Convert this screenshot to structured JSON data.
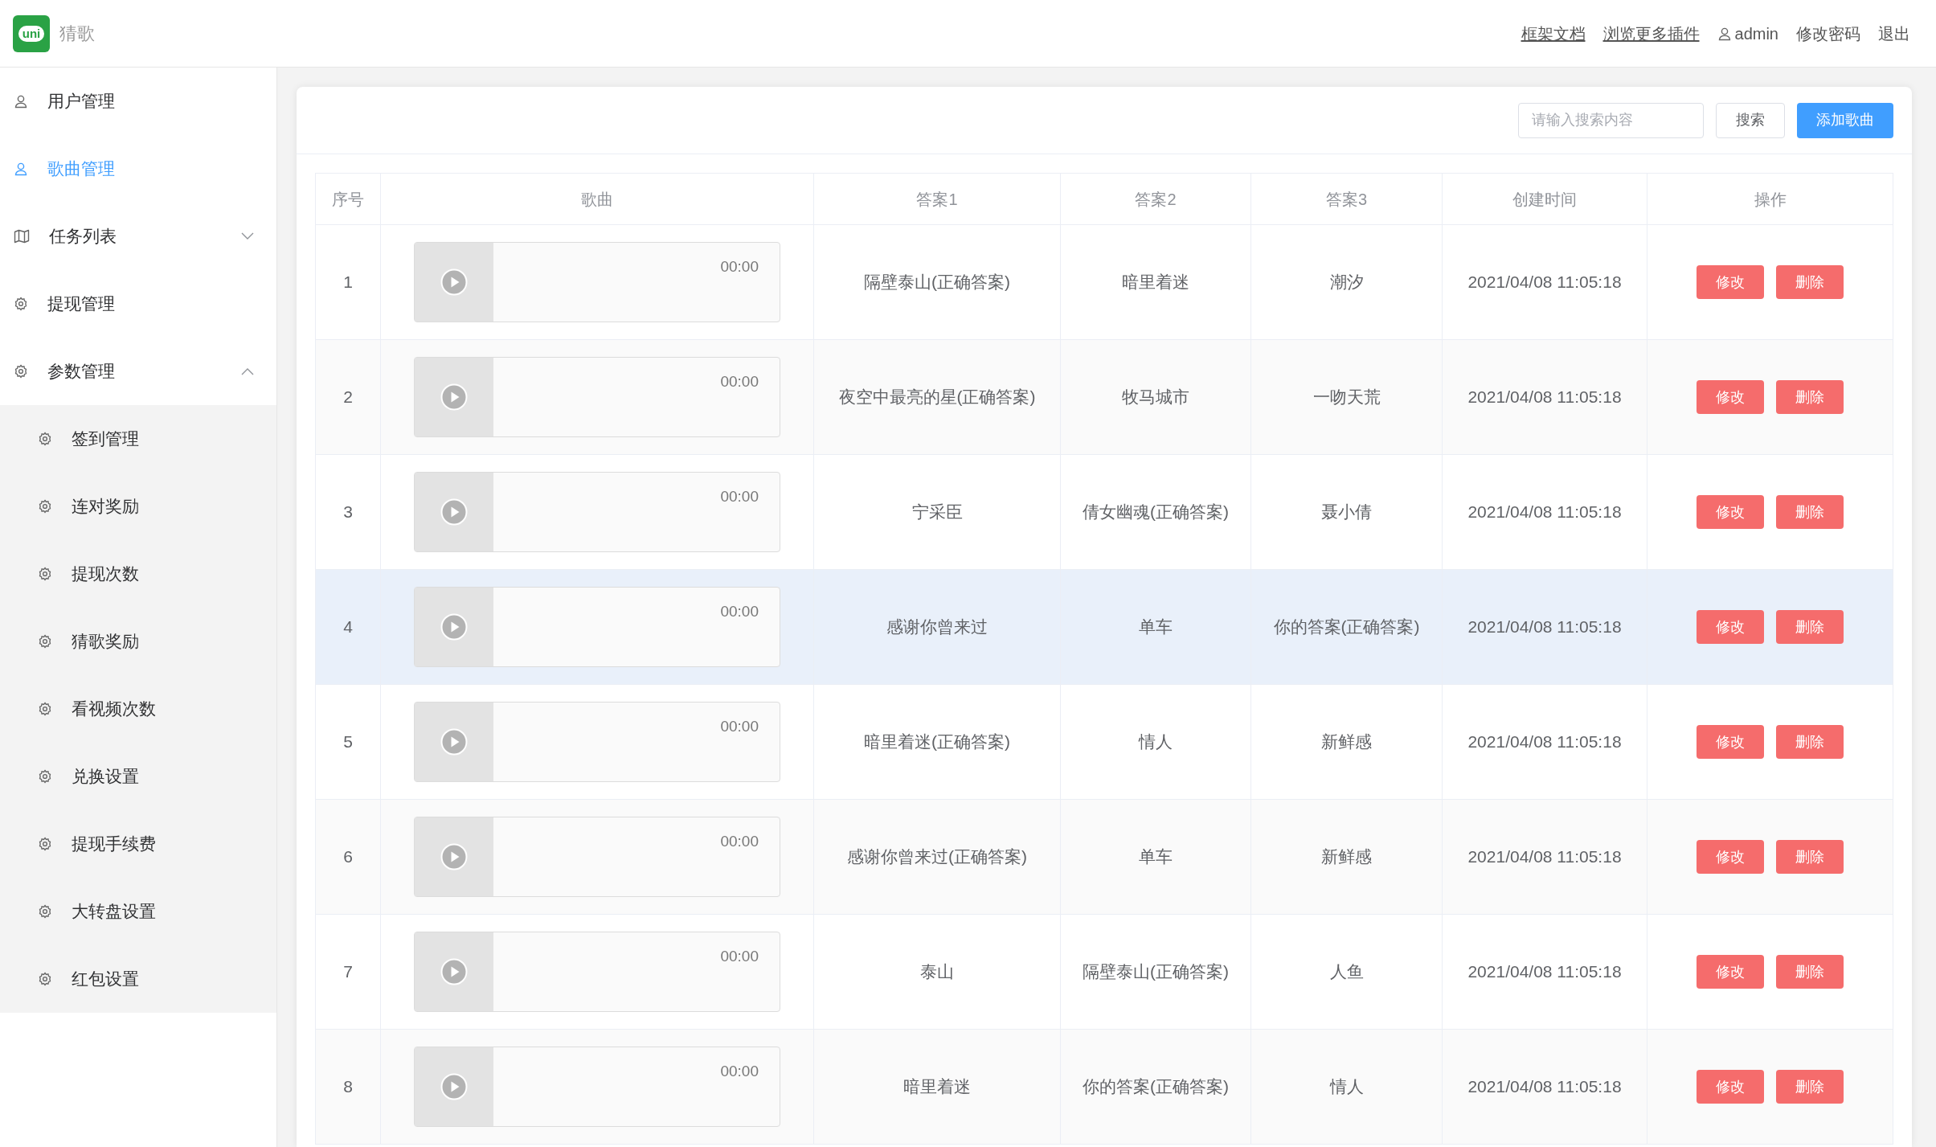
{
  "header": {
    "logo_text": "uni",
    "app_name": "猜歌",
    "links": [
      {
        "label": "框架文档",
        "kind": "link"
      },
      {
        "label": "浏览更多插件",
        "kind": "link"
      },
      {
        "label": "admin",
        "kind": "user"
      },
      {
        "label": "修改密码",
        "kind": "plain"
      },
      {
        "label": "退出",
        "kind": "plain"
      }
    ]
  },
  "sidebar": {
    "items": [
      {
        "label": "用户管理",
        "kind": "user",
        "selected": false
      },
      {
        "label": "歌曲管理",
        "kind": "user",
        "selected": true
      },
      {
        "label": "任务列表",
        "kind": "map",
        "selected": false,
        "expanded": false
      },
      {
        "label": "提现管理",
        "kind": "gear",
        "selected": false
      },
      {
        "label": "参数管理",
        "kind": "gear",
        "selected": false,
        "expanded": true,
        "children": [
          {
            "label": "签到管理",
            "selected": false
          },
          {
            "label": "连对奖励",
            "selected": false
          },
          {
            "label": "提现次数",
            "selected": false
          },
          {
            "label": "猜歌奖励",
            "selected": false
          },
          {
            "label": "看视频次数",
            "selected": false
          },
          {
            "label": "兑换设置",
            "selected": false
          },
          {
            "label": "提现手续费",
            "selected": false
          },
          {
            "label": "大转盘设置",
            "selected": false
          },
          {
            "label": "红包设置",
            "selected": false
          }
        ]
      }
    ]
  },
  "toolbar": {
    "search": {
      "placeholder": "请输入搜索内容"
    },
    "search_button": "搜索",
    "add_button": "添加歌曲"
  },
  "table": {
    "columns": [
      "序号",
      "歌曲",
      "答案1",
      "答案2",
      "答案3",
      "创建时间",
      "操作"
    ],
    "rows": [
      {
        "index": "1",
        "time_display": "00:00",
        "answer1": "隔壁泰山(正确答案)",
        "answer2": "暗里着迷",
        "answer3": "潮汐",
        "created": "2021/04/08 11:05:18",
        "actions": [
          "修改",
          "删除"
        ],
        "highlighted": false
      },
      {
        "index": "2",
        "time_display": "00:00",
        "answer1": "夜空中最亮的星(正确答案)",
        "answer2": "牧马城市",
        "answer3": "一吻天荒",
        "created": "2021/04/08 11:05:18",
        "actions": [
          "修改",
          "删除"
        ],
        "highlighted": false
      },
      {
        "index": "3",
        "time_display": "00:00",
        "answer1": "宁采臣",
        "answer2": "倩女幽魂(正确答案)",
        "answer3": "聂小倩",
        "created": "2021/04/08 11:05:18",
        "actions": [
          "修改",
          "删除"
        ],
        "highlighted": false
      },
      {
        "index": "4",
        "time_display": "00:00",
        "answer1": "感谢你曾来过",
        "answer2": "单车",
        "answer3": "你的答案(正确答案)",
        "created": "2021/04/08 11:05:18",
        "actions": [
          "修改",
          "删除"
        ],
        "highlighted": true
      },
      {
        "index": "5",
        "time_display": "00:00",
        "answer1": "暗里着迷(正确答案)",
        "answer2": "情人",
        "answer3": "新鲜感",
        "created": "2021/04/08 11:05:18",
        "actions": [
          "修改",
          "删除"
        ],
        "highlighted": false
      },
      {
        "index": "6",
        "time_display": "00:00",
        "answer1": "感谢你曾来过(正确答案)",
        "answer2": "单车",
        "answer3": "新鲜感",
        "created": "2021/04/08 11:05:18",
        "actions": [
          "修改",
          "删除"
        ],
        "highlighted": false
      },
      {
        "index": "7",
        "time_display": "00:00",
        "answer1": "泰山",
        "answer2": "隔壁泰山(正确答案)",
        "answer3": "人鱼",
        "created": "2021/04/08 11:05:18",
        "actions": [
          "修改",
          "删除"
        ],
        "highlighted": false
      },
      {
        "index": "8",
        "time_display": "00:00",
        "answer1": "暗里着迷",
        "answer2": "你的答案(正确答案)",
        "answer3": "情人",
        "created": "2021/04/08 11:05:18",
        "actions": [
          "修改",
          "删除"
        ],
        "highlighted": false
      }
    ]
  }
}
